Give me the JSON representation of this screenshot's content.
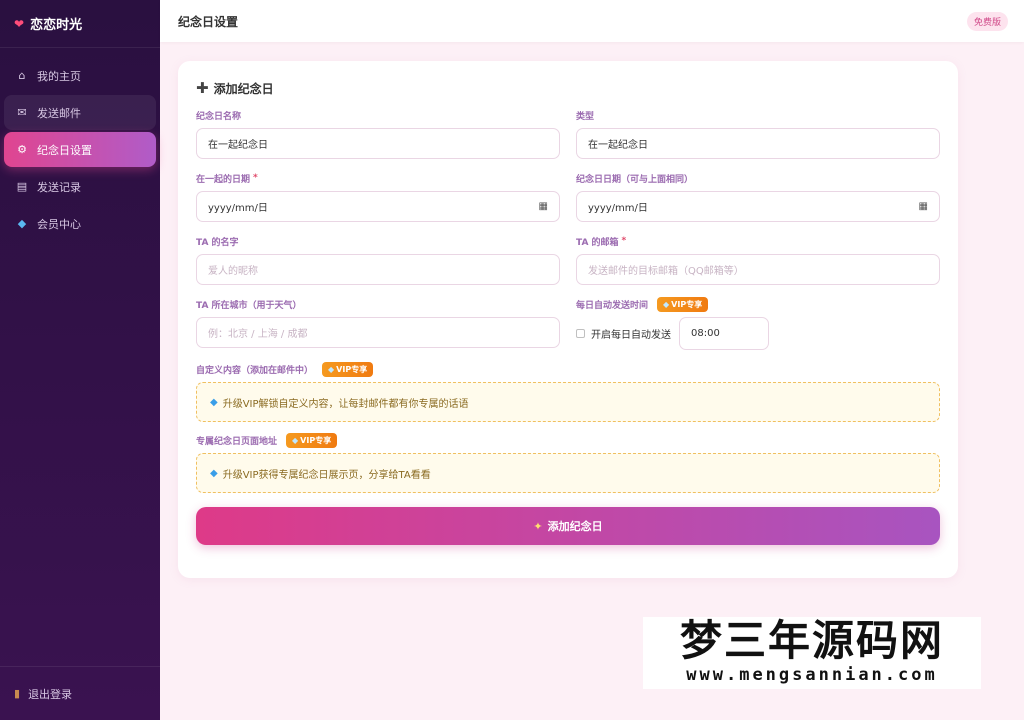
{
  "brand": {
    "name": "恋恋时光"
  },
  "sidebar": {
    "items": [
      {
        "label": "我的主页"
      },
      {
        "label": "发送邮件"
      },
      {
        "label": "纪念日设置"
      },
      {
        "label": "发送记录"
      },
      {
        "label": "会员中心"
      }
    ],
    "logout": "退出登录"
  },
  "topbar": {
    "title": "纪念日设置",
    "plan": "免费版"
  },
  "form": {
    "title": "添加纪念日",
    "name": {
      "label": "纪念日名称",
      "value": "在一起纪念日"
    },
    "type": {
      "label": "类型",
      "value": "在一起纪念日"
    },
    "together_date": {
      "label": "在一起的日期",
      "required": "*",
      "value": "yyyy/mm/日"
    },
    "anniv_date": {
      "label": "纪念日日期（可与上面相同）",
      "value": "yyyy/mm/日"
    },
    "ta_name": {
      "label": "TA 的名字",
      "placeholder": "爱人的昵称"
    },
    "ta_email": {
      "label": "TA 的邮箱",
      "required": "*",
      "placeholder": "发送邮件的目标邮箱（QQ邮箱等）"
    },
    "ta_city": {
      "label": "TA 所在城市（用于天气）",
      "placeholder": "例：北京 / 上海 / 成都"
    },
    "auto_send": {
      "label": "每日自动发送时间",
      "vip": "VIP专享",
      "checkbox_label": "开启每日自动发送",
      "time": "08:00"
    },
    "custom_content": {
      "label": "自定义内容（添加在邮件中）",
      "vip": "VIP专享",
      "upsell": "升级VIP解锁自定义内容，让每封邮件都有你专属的话语"
    },
    "page_url": {
      "label": "专属纪念日页面地址",
      "vip": "VIP专享",
      "upsell": "升级VIP获得专属纪念日展示页，分享给TA看看"
    },
    "submit": "添加纪念日"
  },
  "watermark": {
    "cn": "梦三年源码网",
    "url": "www.mengsannian.com"
  },
  "colors": {
    "sidebar_bg": "#2a1040",
    "accent": "#e04590",
    "accent2": "#b05cc8",
    "vip": "#f59a20"
  }
}
